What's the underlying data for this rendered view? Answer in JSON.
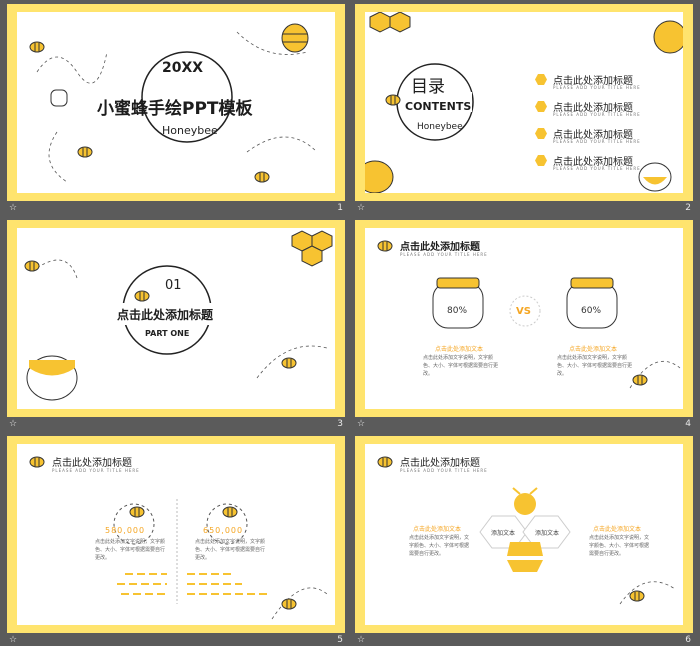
{
  "colors": {
    "border": "#ffe46e",
    "accent": "#f5a623",
    "bee_yellow": "#f7c331",
    "bg": "#5b5b5b",
    "ink": "#1d1d1d"
  },
  "slides": [
    {
      "number": "1",
      "star": "☆",
      "year": "20XX",
      "title": "小蜜蜂手绘PPT模板",
      "subtitle": "Honeybee"
    },
    {
      "number": "2",
      "star": "☆",
      "heading": "目录",
      "contents": "CONTENTS",
      "subtitle": "Honeybee",
      "items": [
        {
          "icon": "01",
          "label": "点击此处添加标题",
          "sub": "PLEASE ADD YOUR TITLE HERE"
        },
        {
          "icon": "02",
          "label": "点击此处添加标题",
          "sub": "PLEASE ADD YOUR TITLE HERE"
        },
        {
          "icon": "03",
          "label": "点击此处添加标题",
          "sub": "PLEASE ADD YOUR TITLE HERE"
        },
        {
          "icon": "04",
          "label": "点击此处添加标题",
          "sub": "PLEASE ADD YOUR TITLE HERE"
        }
      ]
    },
    {
      "number": "3",
      "star": "☆",
      "index": "01",
      "title": "点击此处添加标题",
      "part": "PART ONE"
    },
    {
      "number": "4",
      "star": "☆",
      "title": "点击此处添加标题",
      "sub": "PLEASE ADD YOUR TITLE HERE",
      "left_pct": "80%",
      "right_pct": "60%",
      "vs": "VS",
      "left_caption": "点击此处添加文本",
      "right_caption": "点击此处添加文本",
      "left_body": "点击此处添加文字说明，文字颜色、大小、字体可根据需要自行更改。",
      "right_body": "点击此处添加文字说明，文字颜色、大小、字体可根据需要自行更改。"
    },
    {
      "number": "5",
      "star": "☆",
      "title": "点击此处添加标题",
      "sub": "PLEASE ADD YOUR TITLE HERE",
      "left_value": "580,000",
      "right_value": "650,000",
      "left_body": "点击此处添加文字说明，文字颜色、大小、字体可根据需要自行更改。",
      "right_body": "点击此处添加文字说明，文字颜色、大小、字体可根据需要自行更改。"
    },
    {
      "number": "6",
      "star": "☆",
      "title": "点击此处添加标题",
      "sub": "PLEASE ADD YOUR TITLE HERE",
      "left_caption": "点击此处添加文本",
      "right_caption": "点击此处添加文本",
      "hex_left": "添加文本",
      "hex_right": "添加文本",
      "left_body": "点击此处添加文字说明，文字颜色、大小、字体可根据需要自行更改。",
      "right_body": "点击此处添加文字说明，文字颜色、大小、字体可根据需要自行更改。"
    }
  ]
}
